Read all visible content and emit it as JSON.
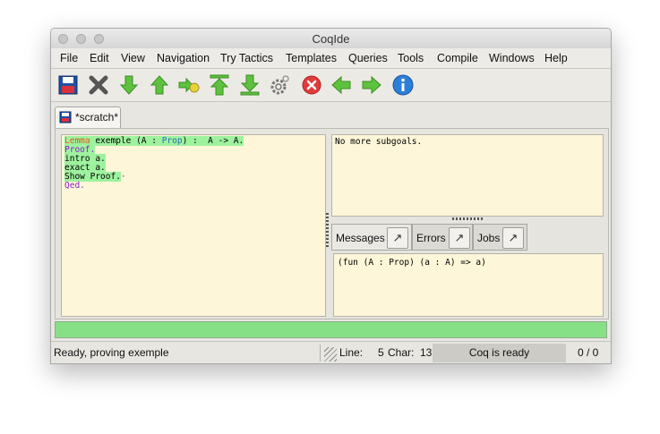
{
  "window": {
    "title": "CoqIde"
  },
  "menu": [
    "File",
    "Edit",
    "View",
    "Navigation",
    "Try Tactics",
    "Templates",
    "Queries",
    "Tools",
    "Compile",
    "Windows",
    "Help"
  ],
  "toolbar": {
    "icons": [
      "save-icon",
      "close-icon",
      "forward-one-icon",
      "backward-one-icon",
      "go-to-cursor-icon",
      "restart-icon",
      "go-to-end-icon",
      "settings-gear-icon",
      "interrupt-icon",
      "previous-icon",
      "next-icon",
      "about-info-icon"
    ],
    "colors": {
      "green": "#5fc23e",
      "red": "#e03c3c",
      "blue": "#2c7fd8"
    }
  },
  "tab": {
    "label": "*scratch*"
  },
  "editor": {
    "lines": {
      "lemma_kw": "Lemma",
      "lemma_name": " exemple (A : ",
      "lemma_type": "Prop",
      "lemma_rest": ") :  A -> A.",
      "proof": "Proof.",
      "intro": "intro a.",
      "exact": "exact a.",
      "show": "Show Proof.",
      "qed": "Qed."
    },
    "colors": {
      "processed": "#9ef29e",
      "keyword": "#e05a1c",
      "terminator": "#8a1fc7",
      "type": "#2c6fbf",
      "background": "#fef6d8"
    }
  },
  "goals": {
    "text": "No more subgoals."
  },
  "message_tabs": [
    {
      "label": "Messages",
      "arrow": "↗"
    },
    {
      "label": "Errors",
      "arrow": "↗"
    },
    {
      "label": "Jobs",
      "arrow": "↗"
    }
  ],
  "messages": {
    "text": "(fun (A : Prop) (a : A) => a)"
  },
  "status": {
    "message": "Ready, proving exemple",
    "line_label": "Line:",
    "line_value": "5",
    "char_label": "Char:",
    "char_value": "13",
    "coq_state": "Coq is ready",
    "counter": "0 / 0"
  }
}
